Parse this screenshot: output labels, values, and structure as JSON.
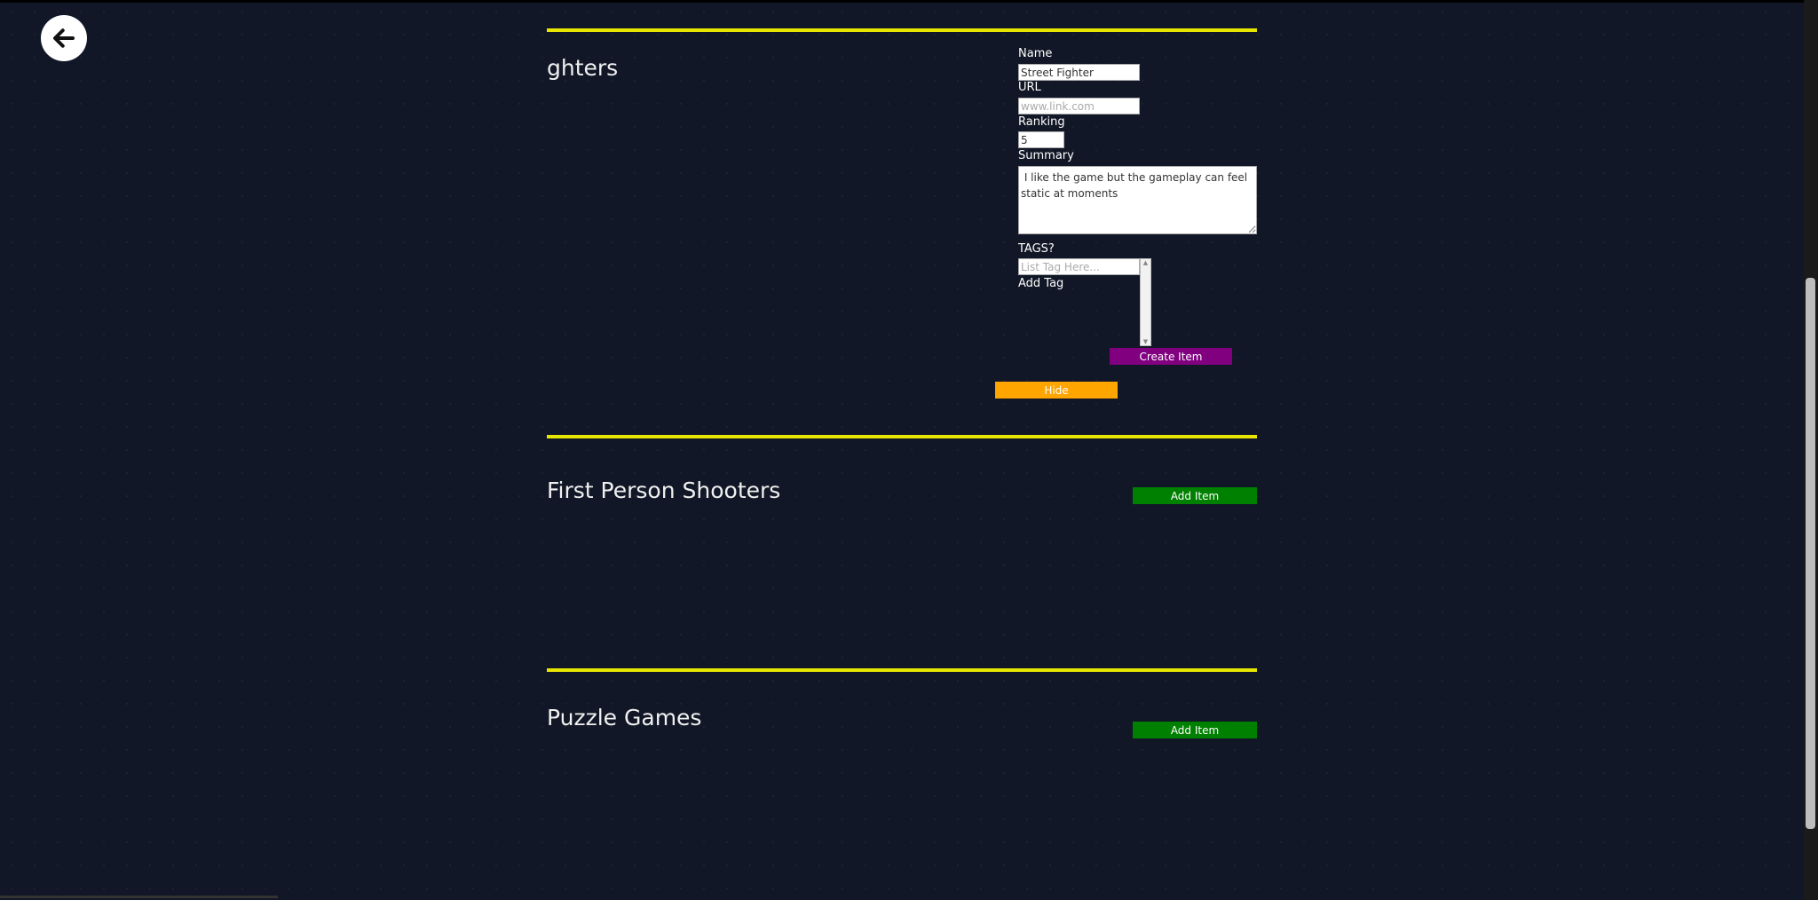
{
  "nav": {
    "back_icon": "arrow-left-icon"
  },
  "sections": [
    {
      "title": "ghters"
    },
    {
      "title": "First Person Shooters",
      "add_label": "Add Item"
    },
    {
      "title": "Puzzle Games",
      "add_label": "Add Item"
    }
  ],
  "form": {
    "name_label": "Name",
    "name_value": "Street Fighter",
    "url_label": "URL",
    "url_placeholder": "www.link.com",
    "ranking_label": "Ranking",
    "ranking_value": "5",
    "summary_label": "Summary",
    "summary_value": " I like the game but the gameplay can feel static at moments",
    "tags_label": "TAGS?",
    "tag_placeholder": "List Tag Here...",
    "add_tag_label": "Add Tag",
    "create_label": "Create Item",
    "hide_label": "Hide"
  },
  "colors": {
    "accent_rule": "#e6e600",
    "create": "#800080",
    "hide": "#ffa500",
    "add": "#008000",
    "background": "#111726"
  }
}
